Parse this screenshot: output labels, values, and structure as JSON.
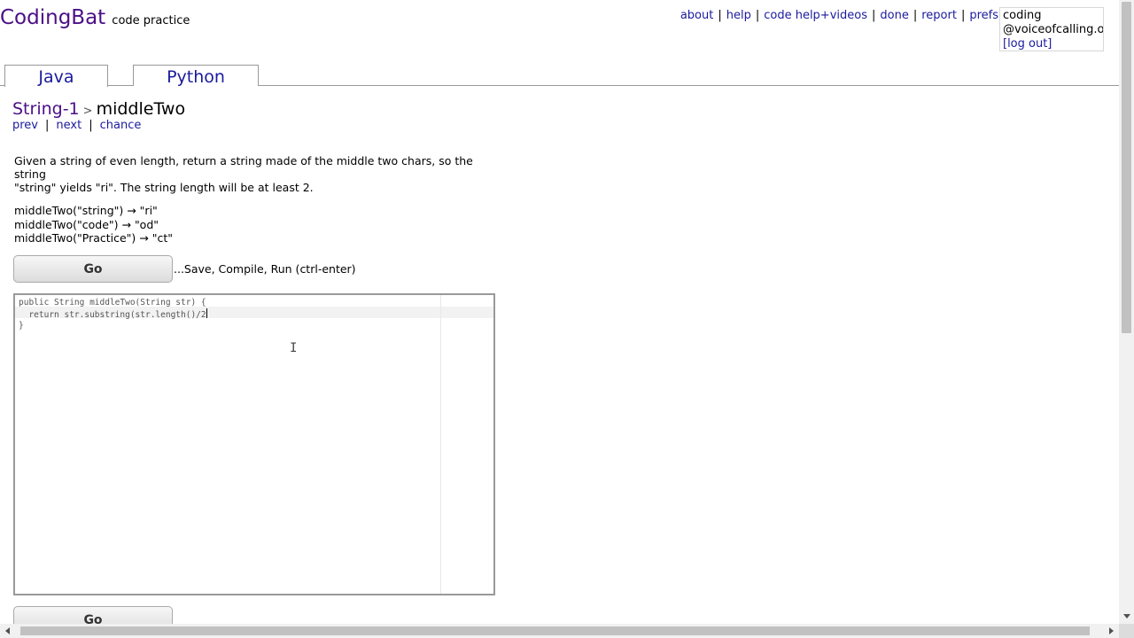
{
  "header": {
    "logo": "CodingBat",
    "tagline": "code practice",
    "links": [
      "about",
      "help",
      "code help+videos",
      "done",
      "report",
      "prefs"
    ],
    "user": {
      "line1": "coding",
      "line2": "@voiceofcalling.org",
      "logout": "[log out]"
    }
  },
  "tabs": {
    "java": "Java",
    "python": "Python"
  },
  "breadcrumb": {
    "section": "String-1",
    "separator": ">",
    "problem": "middleTwo"
  },
  "subnav": {
    "prev": "prev",
    "next": "next",
    "chance": "chance",
    "separator": "|"
  },
  "problem": {
    "description_line1": "Given a string of even length, return a string made of the middle two chars, so the string",
    "description_line2": "\"string\" yields \"ri\". The string length will be at least 2.",
    "examples": [
      "middleTwo(\"string\") → \"ri\"",
      "middleTwo(\"code\") → \"od\"",
      "middleTwo(\"Practice\") → \"ct\""
    ]
  },
  "actions": {
    "go_label": "Go",
    "go_hint": "...Save, Compile, Run (ctrl-enter)"
  },
  "editor": {
    "lines": [
      "public String middleTwo(String str) {",
      "  return str.substring(str.length()/2",
      "}"
    ]
  },
  "colors": {
    "logo": "#4b0f86",
    "link": "#1a1a9e",
    "border": "#999999"
  },
  "icons": {
    "cursor": "text-cursor-ibeam-icon",
    "scroll_up": "scroll-up-arrow-icon",
    "scroll_down": "scroll-down-arrow-icon",
    "scroll_left": "scroll-left-arrow-icon",
    "scroll_right": "scroll-right-arrow-icon"
  }
}
